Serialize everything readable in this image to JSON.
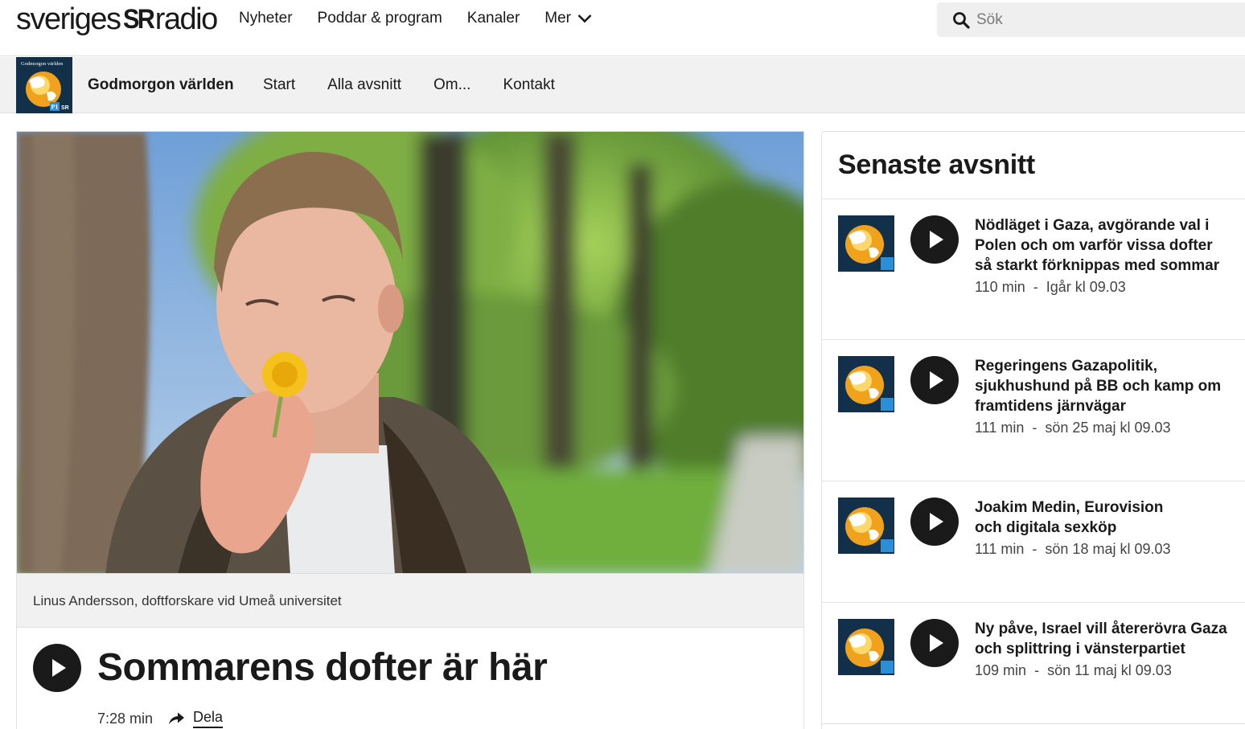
{
  "header": {
    "logo_left": "sveriges",
    "logo_mark": "SR",
    "logo_right": "radio",
    "nav": [
      "Nyheter",
      "Poddar & program",
      "Kanaler",
      "Mer"
    ],
    "search_placeholder": "Sök",
    "search_icon": "search-icon"
  },
  "program": {
    "image_text": "Godmorgon världen",
    "image_badges": [
      "P1",
      "SR"
    ],
    "title": "Godmorgon världen",
    "nav": [
      "Start",
      "Alla avsnitt",
      "Om...",
      "Kontakt"
    ]
  },
  "hero": {
    "caption": "Linus Andersson, doftforskare vid Umeå universitet"
  },
  "article": {
    "title": "Sommarens dofter är här",
    "duration": "7:28 min",
    "share_label": "Dela",
    "share_icon": "share-arrow-icon"
  },
  "sidebar": {
    "heading": "Senaste avsnitt",
    "episodes": [
      {
        "title": "Nödläget i Gaza, avgörande val i Polen och om varför vissa dofter så starkt förknippas med sommar",
        "duration": "110 min",
        "date": "Igår kl 09.03"
      },
      {
        "title": "Regeringens Gazapolitik, sjukhushund på BB och kamp om framtidens järnvägar",
        "duration": "111 min",
        "date": "sön 25 maj kl 09.03"
      },
      {
        "title": "Joakim Medin, Eurovision och digitala sexköp",
        "duration": "111 min",
        "date": "sön 18 maj kl 09.03"
      },
      {
        "title": "Ny påve, Israel vill återerövra Gaza och splittring i vänsterpartiet",
        "duration": "109 min",
        "date": "sön 11 maj kl 09.03"
      }
    ],
    "meta_separator": "-"
  },
  "colors": {
    "text": "#1a1a1a",
    "nav_bg": "#f1f1f1",
    "search_bg": "#efefef",
    "thumb_bg": "#123049",
    "p1_badge": "#2a8fd6"
  }
}
